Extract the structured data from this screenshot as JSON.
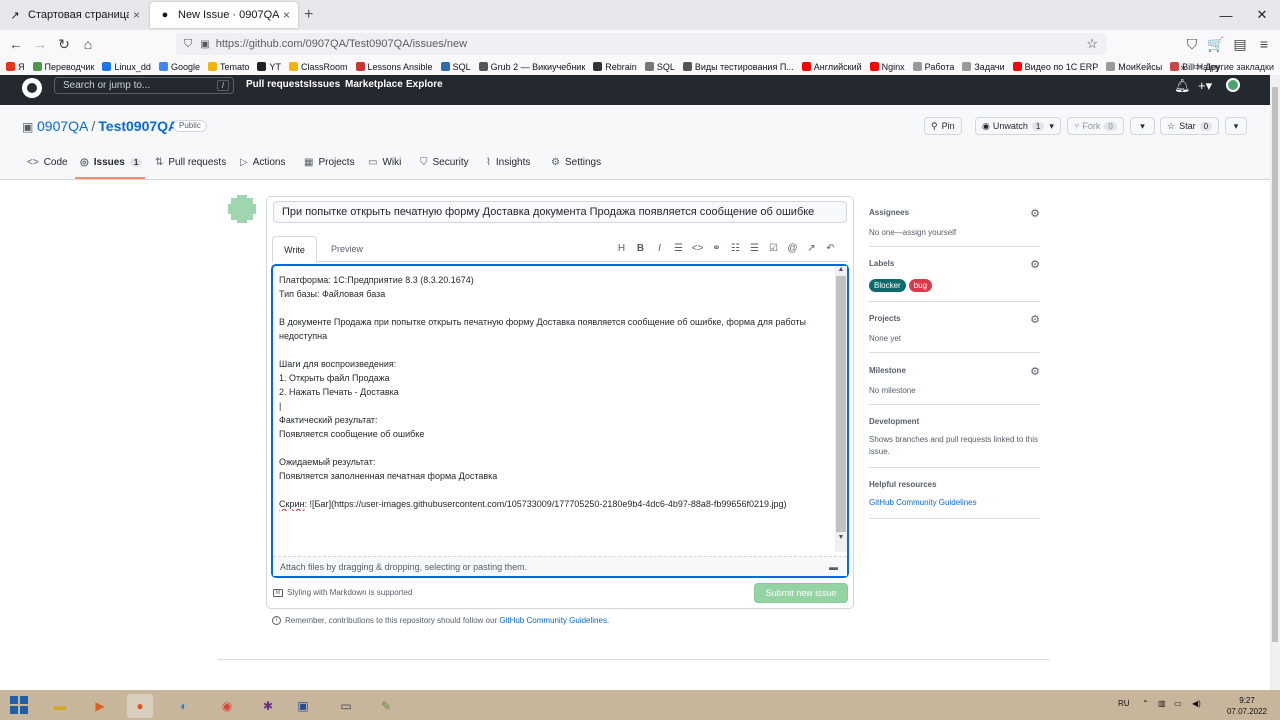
{
  "browser": {
    "tabs": [
      {
        "title": "Стартовая страница курса «С",
        "icon": "moodle-icon"
      },
      {
        "title": "New Issue · 0907QA/Test0907QA",
        "icon": "github-icon"
      }
    ],
    "url": "https://github.com/0907QA/Test0907QA/issues/new",
    "bookmarks": [
      {
        "label": "Я",
        "color": "#e8341c"
      },
      {
        "label": "Переводчик",
        "color": "#4a9a4a"
      },
      {
        "label": "Linux_dd",
        "color": "#1a73e8"
      },
      {
        "label": "Google",
        "color": "#4285f4"
      },
      {
        "label": "Temato",
        "color": "#f4b400"
      },
      {
        "label": "YT",
        "color": "#222222"
      },
      {
        "label": "ClassRoom",
        "color": "#f4b400"
      },
      {
        "label": "Lessons Ansible",
        "color": "#cc3333"
      },
      {
        "label": "SQL",
        "color": "#2b6cb0"
      },
      {
        "label": "Grub 2 — Викиучебник",
        "color": "#555555"
      },
      {
        "label": "Rebrain",
        "color": "#333333"
      },
      {
        "label": "SQL",
        "color": "#777777"
      },
      {
        "label": "Виды тестирования П...",
        "color": "#555555"
      },
      {
        "label": "Английский",
        "color": "#ff0000"
      },
      {
        "label": "Nginx",
        "color": "#ff0000"
      },
      {
        "label": "Работа",
        "color": "#999999"
      },
      {
        "label": "Задачи",
        "color": "#999999"
      },
      {
        "label": "Видео по 1С ERP",
        "color": "#ff0000"
      },
      {
        "label": "МоиКейсы",
        "color": "#999999"
      },
      {
        "label": "Bill Haley",
        "color": "#cc4444"
      }
    ],
    "other_bookmarks": "Другие закладки"
  },
  "github": {
    "search_placeholder": "Search or jump to...",
    "slash_key": "/",
    "nav": [
      "Pull requests",
      "Issues",
      "Marketplace",
      "Explore"
    ]
  },
  "repo": {
    "owner": "0907QA",
    "separator": "/",
    "name": "Test0907QA",
    "visibility": "Public",
    "pin": "Pin",
    "unwatch": "Unwatch",
    "unwatch_count": "1",
    "fork": "Fork",
    "fork_count": "0",
    "star": "Star",
    "star_count": "0",
    "tabs": [
      {
        "label": "Code",
        "icon": "code-icon"
      },
      {
        "label": "Issues",
        "icon": "issue-icon",
        "count": "1"
      },
      {
        "label": "Pull requests",
        "icon": "pull-request-icon"
      },
      {
        "label": "Actions",
        "icon": "actions-icon"
      },
      {
        "label": "Projects",
        "icon": "projects-icon"
      },
      {
        "label": "Wiki",
        "icon": "wiki-icon"
      },
      {
        "label": "Security",
        "icon": "shield-icon"
      },
      {
        "label": "Insights",
        "icon": "graph-icon"
      },
      {
        "label": "Settings",
        "icon": "gear-icon"
      }
    ]
  },
  "issue": {
    "title": "При попытке открыть печатную форму Доставка документа Продажа появляется сообщение об ошибке",
    "write_tab": "Write",
    "preview_tab": "Preview",
    "body_lines": [
      "Платформа: 1С:Предприятие 8.3 (8.3.20.1674)",
      "Тип базы: Файловая база",
      "",
      "В документе Продажа при попытке открыть печатную форму Доставка появляется сообщение об ошибке, форма для работы",
      "недоступна",
      "",
      "Шаги для воспроизведения:",
      "1. Открыть файл Продажа",
      "2. Нажать Печать - Доставка",
      "|",
      "Фактический результат:",
      "Появляется сообщение об ошибке",
      "",
      "Ожидаемый результат:",
      "Появляется заполненная печатная форма Доставка",
      "",
      "Скрин: ![Баг](https://user-images.githubusercontent.com/105733009/177705250-2180e9b4-4dc6-4b97-88a8-fb99656f0219.jpg)"
    ],
    "attach_text": "Attach files by dragging & dropping, selecting or pasting them.",
    "markdown_note": "Styling with Markdown is supported",
    "submit_label": "Submit new issue",
    "remember_text": "Remember, contributions to this repository should follow our",
    "remember_link": "GitHub Community Guidelines",
    "remember_end": "."
  },
  "sidebar": {
    "assignees_title": "Assignees",
    "assignees_value": "No one—assign yourself",
    "labels_title": "Labels",
    "labels": [
      {
        "name": "Blocker",
        "color": "#0e6b6b",
        "text": "#ffffff"
      },
      {
        "name": "bug",
        "color": "#d73a4a",
        "text": "#ffffff"
      }
    ],
    "projects_title": "Projects",
    "projects_value": "None yet",
    "milestone_title": "Milestone",
    "milestone_value": "No milestone",
    "development_title": "Development",
    "development_value": "Shows branches and pull requests linked to this issue.",
    "helpful_title": "Helpful resources",
    "helpful_link": "GitHub Community Guidelines"
  },
  "taskbar": {
    "lang": "RU",
    "time": "9:27",
    "date": "07.07.2022"
  }
}
